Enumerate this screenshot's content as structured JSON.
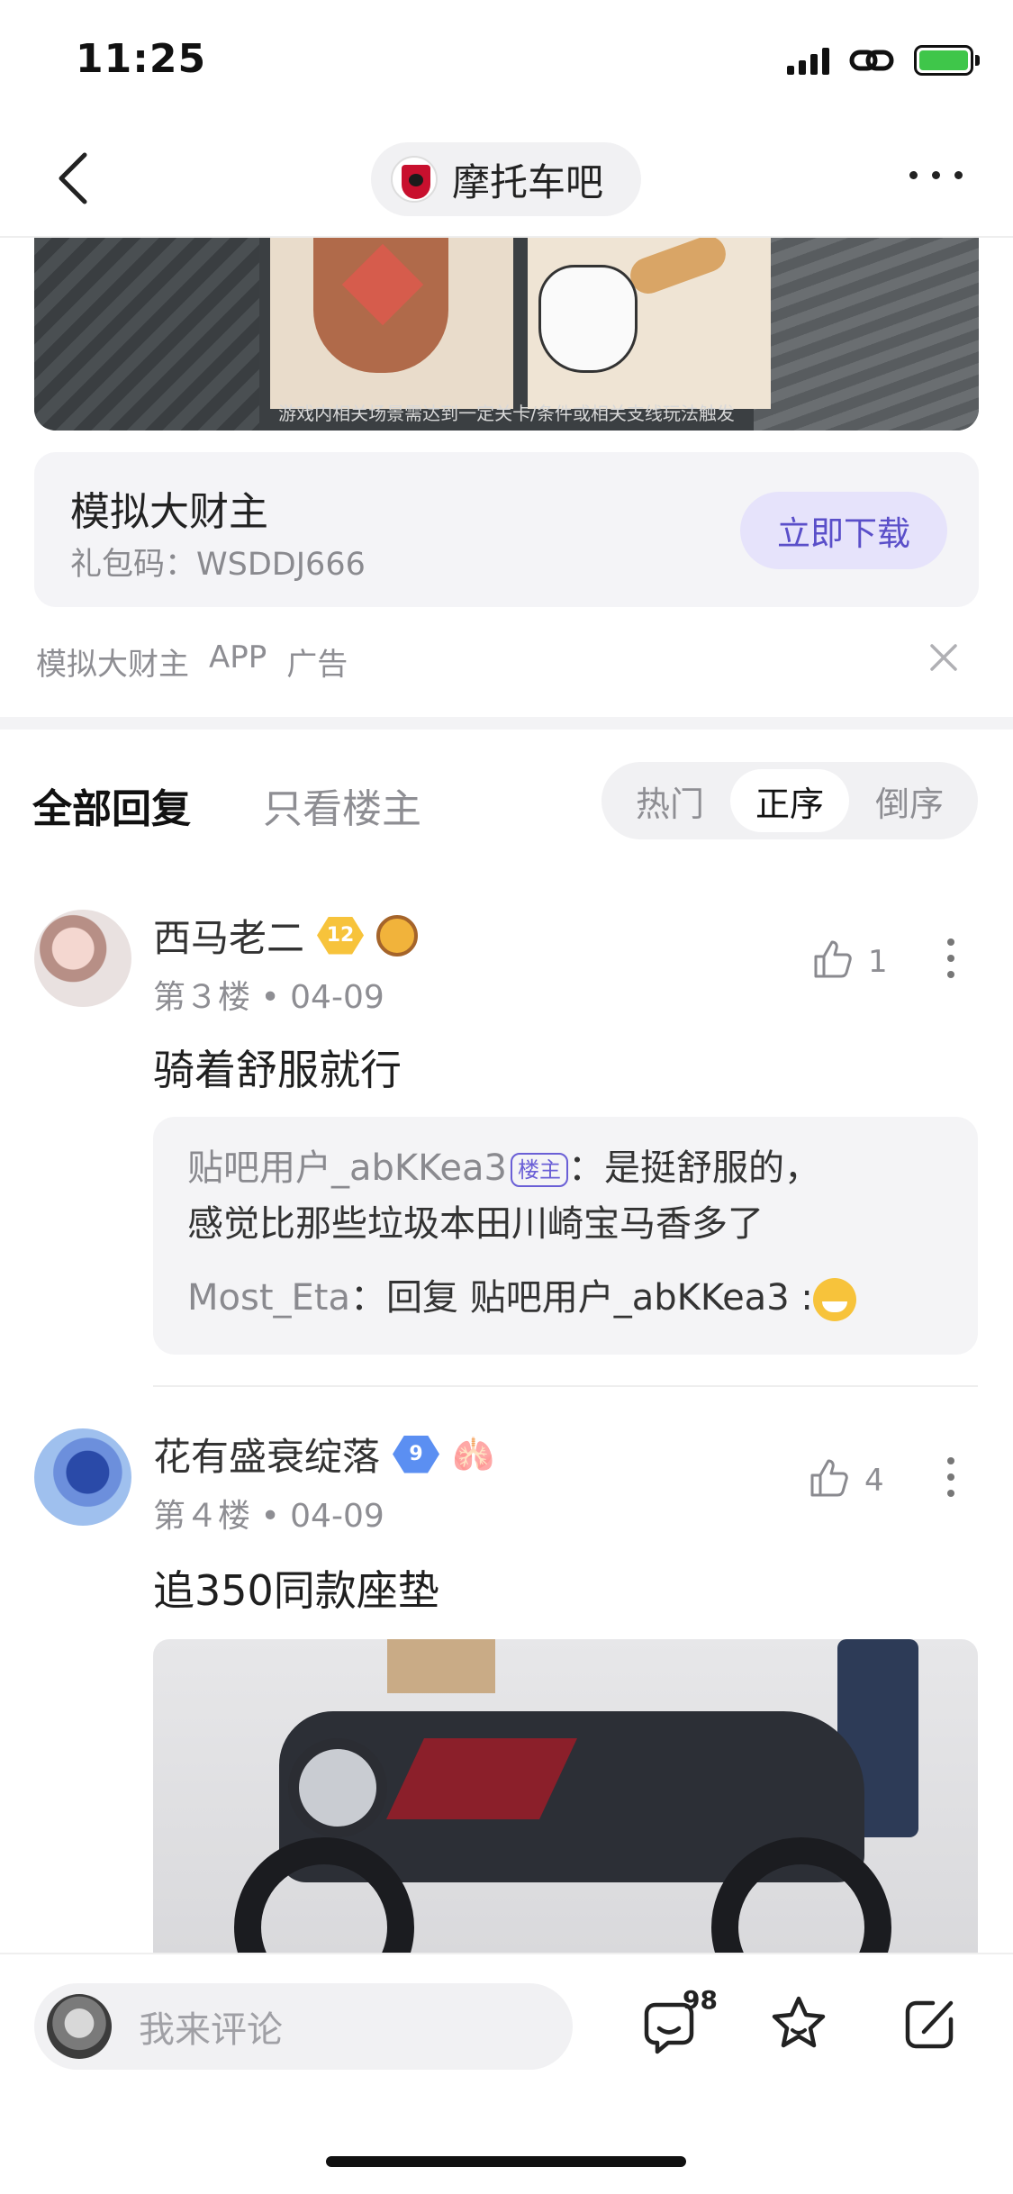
{
  "status_bar": {
    "time": "11:25"
  },
  "nav": {
    "forum_name": "摩托车吧"
  },
  "ad": {
    "image_caption": "游戏内相关场景需达到一定关卡/条件或相关支线玩法触发",
    "app_title": "模拟大财主",
    "gift_code": "礼包码：WSDDJ666",
    "download_label": "立即下载",
    "meta": [
      "模拟大财主",
      "APP",
      "广告"
    ]
  },
  "tabs": {
    "all": "全部回复",
    "op_only": "只看楼主",
    "sort": [
      "热门",
      "正序",
      "倒序"
    ],
    "active_sort": "正序"
  },
  "comments": [
    {
      "username": "西马老二",
      "level": "12",
      "floor": "第３楼",
      "date": "04-09",
      "likes": "1",
      "text": "骑着舒服就行",
      "replies": [
        {
          "name": "贴吧用户_abKKea3",
          "tag": "楼主",
          "text_line1": "：是挺舒服的，",
          "text_line2": "感觉比那些垃圾本田川崎宝马香多了"
        },
        {
          "name": "Most_Eta",
          "text": "：回复 贴吧用户_abKKea3 :"
        }
      ]
    },
    {
      "username": "花有盛衰绽落",
      "level": "9",
      "floor": "第４楼",
      "date": "04-09",
      "likes": "4",
      "text": "追350同款座垫"
    }
  ],
  "bottom_bar": {
    "placeholder": "我来评论",
    "comment_count": "98"
  },
  "colors": {
    "accent": "#5a4fc9",
    "accent_bg": "#e6e3fb",
    "battery": "#3fc64a",
    "level_gold": "#f7c33b",
    "level_blue": "#5b8ff2"
  }
}
